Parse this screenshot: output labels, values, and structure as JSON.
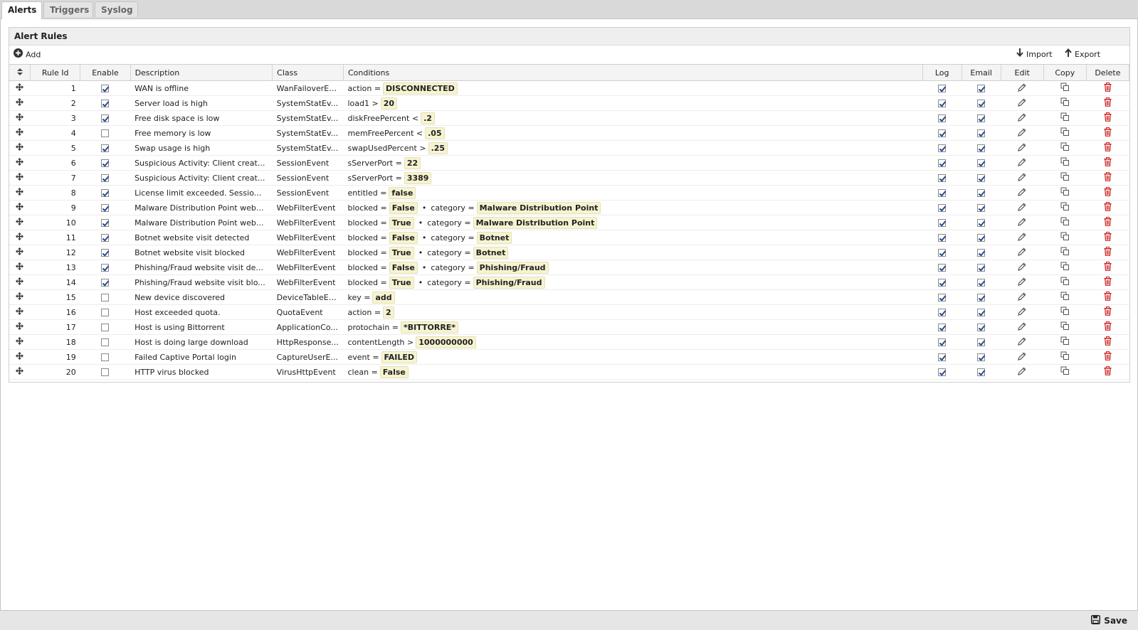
{
  "tabs": [
    {
      "label": "Alerts",
      "active": true
    },
    {
      "label": "Triggers",
      "active": false
    },
    {
      "label": "Syslog",
      "active": false
    }
  ],
  "panel": {
    "title": "Alert Rules"
  },
  "toolbar": {
    "add_label": "Add",
    "import_label": "Import",
    "export_label": "Export"
  },
  "columns": {
    "rule_id": "Rule Id",
    "enable": "Enable",
    "description": "Description",
    "class": "Class",
    "conditions": "Conditions",
    "log": "Log",
    "email": "Email",
    "edit": "Edit",
    "copy": "Copy",
    "delete": "Delete"
  },
  "footer": {
    "save_label": "Save"
  },
  "colors": {
    "delete_icon": "#cc2222",
    "condition_value_bg": "#f6f3d2"
  },
  "rules": [
    {
      "id": "1",
      "enabled": true,
      "description": "WAN is offline",
      "class": "WanFailoverEv...",
      "conditions": [
        {
          "field": "action",
          "op": "=",
          "value": "DISCONNECTED"
        }
      ],
      "log": true,
      "email": true
    },
    {
      "id": "2",
      "enabled": true,
      "description": "Server load is high",
      "class": "SystemStatEv...",
      "conditions": [
        {
          "field": "load1",
          "op": ">",
          "value": "20"
        }
      ],
      "log": true,
      "email": true
    },
    {
      "id": "3",
      "enabled": true,
      "description": "Free disk space is low",
      "class": "SystemStatEv...",
      "conditions": [
        {
          "field": "diskFreePercent",
          "op": "<",
          "value": ".2"
        }
      ],
      "log": true,
      "email": true
    },
    {
      "id": "4",
      "enabled": false,
      "description": "Free memory is low",
      "class": "SystemStatEv...",
      "conditions": [
        {
          "field": "memFreePercent",
          "op": "<",
          "value": ".05"
        }
      ],
      "log": true,
      "email": true
    },
    {
      "id": "5",
      "enabled": true,
      "description": "Swap usage is high",
      "class": "SystemStatEv...",
      "conditions": [
        {
          "field": "swapUsedPercent",
          "op": ">",
          "value": ".25"
        }
      ],
      "log": true,
      "email": true
    },
    {
      "id": "6",
      "enabled": true,
      "description": "Suspicious Activity: Client creat...",
      "class": "SessionEvent",
      "conditions": [
        {
          "field": "sServerPort",
          "op": "=",
          "value": "22"
        }
      ],
      "log": true,
      "email": true
    },
    {
      "id": "7",
      "enabled": true,
      "description": "Suspicious Activity: Client creat...",
      "class": "SessionEvent",
      "conditions": [
        {
          "field": "sServerPort",
          "op": "=",
          "value": "3389"
        }
      ],
      "log": true,
      "email": true
    },
    {
      "id": "8",
      "enabled": true,
      "description": "License limit exceeded. Sessio...",
      "class": "SessionEvent",
      "conditions": [
        {
          "field": "entitled",
          "op": "=",
          "value": "false"
        }
      ],
      "log": true,
      "email": true
    },
    {
      "id": "9",
      "enabled": true,
      "description": "Malware Distribution Point web...",
      "class": "WebFilterEvent",
      "conditions": [
        {
          "field": "blocked",
          "op": "=",
          "value": "False"
        },
        {
          "field": "category",
          "op": "=",
          "value": "Malware Distribution Point"
        }
      ],
      "log": true,
      "email": true
    },
    {
      "id": "10",
      "enabled": true,
      "description": "Malware Distribution Point web...",
      "class": "WebFilterEvent",
      "conditions": [
        {
          "field": "blocked",
          "op": "=",
          "value": "True"
        },
        {
          "field": "category",
          "op": "=",
          "value": "Malware Distribution Point"
        }
      ],
      "log": true,
      "email": true
    },
    {
      "id": "11",
      "enabled": true,
      "description": "Botnet website visit detected",
      "class": "WebFilterEvent",
      "conditions": [
        {
          "field": "blocked",
          "op": "=",
          "value": "False"
        },
        {
          "field": "category",
          "op": "=",
          "value": "Botnet"
        }
      ],
      "log": true,
      "email": true
    },
    {
      "id": "12",
      "enabled": true,
      "description": "Botnet website visit blocked",
      "class": "WebFilterEvent",
      "conditions": [
        {
          "field": "blocked",
          "op": "=",
          "value": "True"
        },
        {
          "field": "category",
          "op": "=",
          "value": "Botnet"
        }
      ],
      "log": true,
      "email": true
    },
    {
      "id": "13",
      "enabled": true,
      "description": "Phishing/Fraud website visit de...",
      "class": "WebFilterEvent",
      "conditions": [
        {
          "field": "blocked",
          "op": "=",
          "value": "False"
        },
        {
          "field": "category",
          "op": "=",
          "value": "Phishing/Fraud"
        }
      ],
      "log": true,
      "email": true
    },
    {
      "id": "14",
      "enabled": true,
      "description": "Phishing/Fraud website visit blo...",
      "class": "WebFilterEvent",
      "conditions": [
        {
          "field": "blocked",
          "op": "=",
          "value": "True"
        },
        {
          "field": "category",
          "op": "=",
          "value": "Phishing/Fraud"
        }
      ],
      "log": true,
      "email": true
    },
    {
      "id": "15",
      "enabled": false,
      "description": "New device discovered",
      "class": "DeviceTableEv...",
      "conditions": [
        {
          "field": "key",
          "op": "=",
          "value": "add"
        }
      ],
      "log": true,
      "email": true
    },
    {
      "id": "16",
      "enabled": false,
      "description": "Host exceeded quota.",
      "class": "QuotaEvent",
      "conditions": [
        {
          "field": "action",
          "op": "=",
          "value": "2"
        }
      ],
      "log": true,
      "email": true
    },
    {
      "id": "17",
      "enabled": false,
      "description": "Host is using Bittorrent",
      "class": "ApplicationCo...",
      "conditions": [
        {
          "field": "protochain",
          "op": "=",
          "value": "*BITTORRE*"
        }
      ],
      "log": true,
      "email": true
    },
    {
      "id": "18",
      "enabled": false,
      "description": "Host is doing large download",
      "class": "HttpResponse...",
      "conditions": [
        {
          "field": "contentLength",
          "op": ">",
          "value": "1000000000"
        }
      ],
      "log": true,
      "email": true
    },
    {
      "id": "19",
      "enabled": false,
      "description": "Failed Captive Portal login",
      "class": "CaptureUserE...",
      "conditions": [
        {
          "field": "event",
          "op": "=",
          "value": "FAILED"
        }
      ],
      "log": true,
      "email": true
    },
    {
      "id": "20",
      "enabled": false,
      "description": "HTTP virus blocked",
      "class": "VirusHttpEvent",
      "conditions": [
        {
          "field": "clean",
          "op": "=",
          "value": "False"
        }
      ],
      "log": true,
      "email": true
    }
  ]
}
